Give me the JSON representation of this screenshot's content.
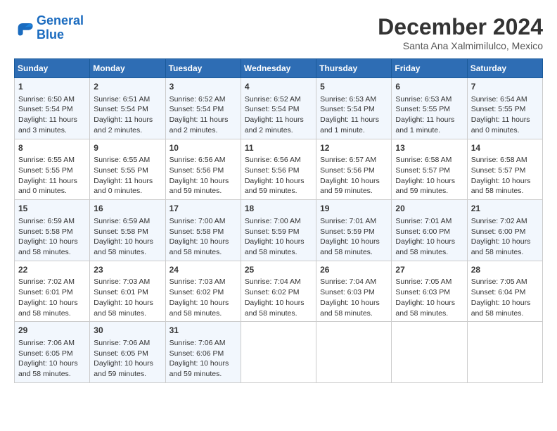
{
  "header": {
    "logo_line1": "General",
    "logo_line2": "Blue",
    "month": "December 2024",
    "location": "Santa Ana Xalmimilulco, Mexico"
  },
  "weekdays": [
    "Sunday",
    "Monday",
    "Tuesday",
    "Wednesday",
    "Thursday",
    "Friday",
    "Saturday"
  ],
  "weeks": [
    [
      {
        "day": "1",
        "line1": "Sunrise: 6:50 AM",
        "line2": "Sunset: 5:54 PM",
        "line3": "Daylight: 11 hours",
        "line4": "and 3 minutes."
      },
      {
        "day": "2",
        "line1": "Sunrise: 6:51 AM",
        "line2": "Sunset: 5:54 PM",
        "line3": "Daylight: 11 hours",
        "line4": "and 2 minutes."
      },
      {
        "day": "3",
        "line1": "Sunrise: 6:52 AM",
        "line2": "Sunset: 5:54 PM",
        "line3": "Daylight: 11 hours",
        "line4": "and 2 minutes."
      },
      {
        "day": "4",
        "line1": "Sunrise: 6:52 AM",
        "line2": "Sunset: 5:54 PM",
        "line3": "Daylight: 11 hours",
        "line4": "and 2 minutes."
      },
      {
        "day": "5",
        "line1": "Sunrise: 6:53 AM",
        "line2": "Sunset: 5:54 PM",
        "line3": "Daylight: 11 hours",
        "line4": "and 1 minute."
      },
      {
        "day": "6",
        "line1": "Sunrise: 6:53 AM",
        "line2": "Sunset: 5:55 PM",
        "line3": "Daylight: 11 hours",
        "line4": "and 1 minute."
      },
      {
        "day": "7",
        "line1": "Sunrise: 6:54 AM",
        "line2": "Sunset: 5:55 PM",
        "line3": "Daylight: 11 hours",
        "line4": "and 0 minutes."
      }
    ],
    [
      {
        "day": "8",
        "line1": "Sunrise: 6:55 AM",
        "line2": "Sunset: 5:55 PM",
        "line3": "Daylight: 11 hours",
        "line4": "and 0 minutes."
      },
      {
        "day": "9",
        "line1": "Sunrise: 6:55 AM",
        "line2": "Sunset: 5:55 PM",
        "line3": "Daylight: 11 hours",
        "line4": "and 0 minutes."
      },
      {
        "day": "10",
        "line1": "Sunrise: 6:56 AM",
        "line2": "Sunset: 5:56 PM",
        "line3": "Daylight: 10 hours",
        "line4": "and 59 minutes."
      },
      {
        "day": "11",
        "line1": "Sunrise: 6:56 AM",
        "line2": "Sunset: 5:56 PM",
        "line3": "Daylight: 10 hours",
        "line4": "and 59 minutes."
      },
      {
        "day": "12",
        "line1": "Sunrise: 6:57 AM",
        "line2": "Sunset: 5:56 PM",
        "line3": "Daylight: 10 hours",
        "line4": "and 59 minutes."
      },
      {
        "day": "13",
        "line1": "Sunrise: 6:58 AM",
        "line2": "Sunset: 5:57 PM",
        "line3": "Daylight: 10 hours",
        "line4": "and 59 minutes."
      },
      {
        "day": "14",
        "line1": "Sunrise: 6:58 AM",
        "line2": "Sunset: 5:57 PM",
        "line3": "Daylight: 10 hours",
        "line4": "and 58 minutes."
      }
    ],
    [
      {
        "day": "15",
        "line1": "Sunrise: 6:59 AM",
        "line2": "Sunset: 5:58 PM",
        "line3": "Daylight: 10 hours",
        "line4": "and 58 minutes."
      },
      {
        "day": "16",
        "line1": "Sunrise: 6:59 AM",
        "line2": "Sunset: 5:58 PM",
        "line3": "Daylight: 10 hours",
        "line4": "and 58 minutes."
      },
      {
        "day": "17",
        "line1": "Sunrise: 7:00 AM",
        "line2": "Sunset: 5:58 PM",
        "line3": "Daylight: 10 hours",
        "line4": "and 58 minutes."
      },
      {
        "day": "18",
        "line1": "Sunrise: 7:00 AM",
        "line2": "Sunset: 5:59 PM",
        "line3": "Daylight: 10 hours",
        "line4": "and 58 minutes."
      },
      {
        "day": "19",
        "line1": "Sunrise: 7:01 AM",
        "line2": "Sunset: 5:59 PM",
        "line3": "Daylight: 10 hours",
        "line4": "and 58 minutes."
      },
      {
        "day": "20",
        "line1": "Sunrise: 7:01 AM",
        "line2": "Sunset: 6:00 PM",
        "line3": "Daylight: 10 hours",
        "line4": "and 58 minutes."
      },
      {
        "day": "21",
        "line1": "Sunrise: 7:02 AM",
        "line2": "Sunset: 6:00 PM",
        "line3": "Daylight: 10 hours",
        "line4": "and 58 minutes."
      }
    ],
    [
      {
        "day": "22",
        "line1": "Sunrise: 7:02 AM",
        "line2": "Sunset: 6:01 PM",
        "line3": "Daylight: 10 hours",
        "line4": "and 58 minutes."
      },
      {
        "day": "23",
        "line1": "Sunrise: 7:03 AM",
        "line2": "Sunset: 6:01 PM",
        "line3": "Daylight: 10 hours",
        "line4": "and 58 minutes."
      },
      {
        "day": "24",
        "line1": "Sunrise: 7:03 AM",
        "line2": "Sunset: 6:02 PM",
        "line3": "Daylight: 10 hours",
        "line4": "and 58 minutes."
      },
      {
        "day": "25",
        "line1": "Sunrise: 7:04 AM",
        "line2": "Sunset: 6:02 PM",
        "line3": "Daylight: 10 hours",
        "line4": "and 58 minutes."
      },
      {
        "day": "26",
        "line1": "Sunrise: 7:04 AM",
        "line2": "Sunset: 6:03 PM",
        "line3": "Daylight: 10 hours",
        "line4": "and 58 minutes."
      },
      {
        "day": "27",
        "line1": "Sunrise: 7:05 AM",
        "line2": "Sunset: 6:03 PM",
        "line3": "Daylight: 10 hours",
        "line4": "and 58 minutes."
      },
      {
        "day": "28",
        "line1": "Sunrise: 7:05 AM",
        "line2": "Sunset: 6:04 PM",
        "line3": "Daylight: 10 hours",
        "line4": "and 58 minutes."
      }
    ],
    [
      {
        "day": "29",
        "line1": "Sunrise: 7:06 AM",
        "line2": "Sunset: 6:05 PM",
        "line3": "Daylight: 10 hours",
        "line4": "and 58 minutes."
      },
      {
        "day": "30",
        "line1": "Sunrise: 7:06 AM",
        "line2": "Sunset: 6:05 PM",
        "line3": "Daylight: 10 hours",
        "line4": "and 59 minutes."
      },
      {
        "day": "31",
        "line1": "Sunrise: 7:06 AM",
        "line2": "Sunset: 6:06 PM",
        "line3": "Daylight: 10 hours",
        "line4": "and 59 minutes."
      },
      null,
      null,
      null,
      null
    ]
  ]
}
